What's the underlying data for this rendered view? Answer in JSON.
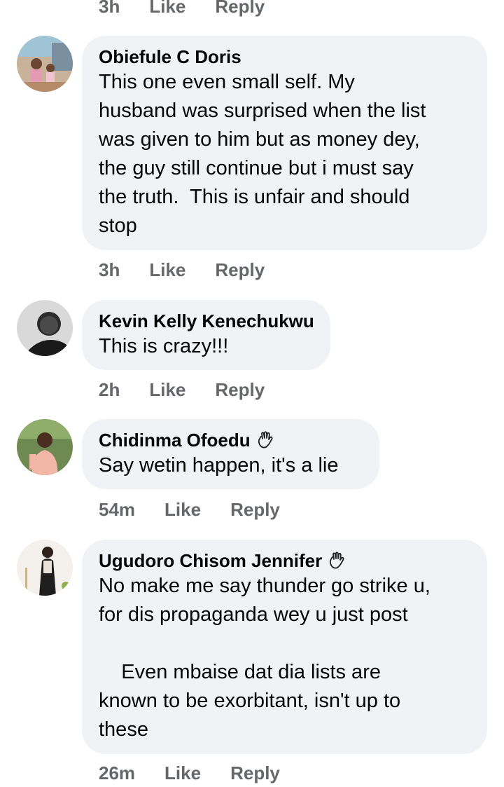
{
  "top_meta": {
    "time": "3h",
    "like": "Like",
    "reply": "Reply"
  },
  "comments": [
    {
      "author": "Obiefule C Doris",
      "lines": [
        "This one even small self. My",
        "husband was surprised when the list",
        "was given to him but as money dey,",
        "the guy still continue but i must say",
        "the truth.  This is unfair and should",
        "stop"
      ],
      "time": "3h",
      "like": "Like",
      "reply": "Reply",
      "avatar_icon": "person-photo-icon"
    },
    {
      "author": "Kevin Kelly Kenechukwu",
      "lines": [
        "This is crazy!!!"
      ],
      "time": "2h",
      "like": "Like",
      "reply": "Reply",
      "avatar_icon": "person-photo-icon"
    },
    {
      "author": "Chidinma Ofoedu",
      "badge_icon": "wave-hand-icon",
      "lines": [
        "Say wetin happen, it's a lie"
      ],
      "time": "54m",
      "like": "Like",
      "reply": "Reply",
      "avatar_icon": "person-photo-icon"
    },
    {
      "author": "Ugudoro Chisom Jennifer",
      "badge_icon": "wave-hand-icon",
      "lines": [
        "No make me say thunder go strike u,",
        "for dis propaganda wey u just post",
        "",
        "    Even mbaise dat dia lists are",
        "known to be exorbitant, isn't up to",
        "these"
      ],
      "time": "26m",
      "like": "Like",
      "reply": "Reply",
      "avatar_icon": "person-photo-icon"
    }
  ]
}
